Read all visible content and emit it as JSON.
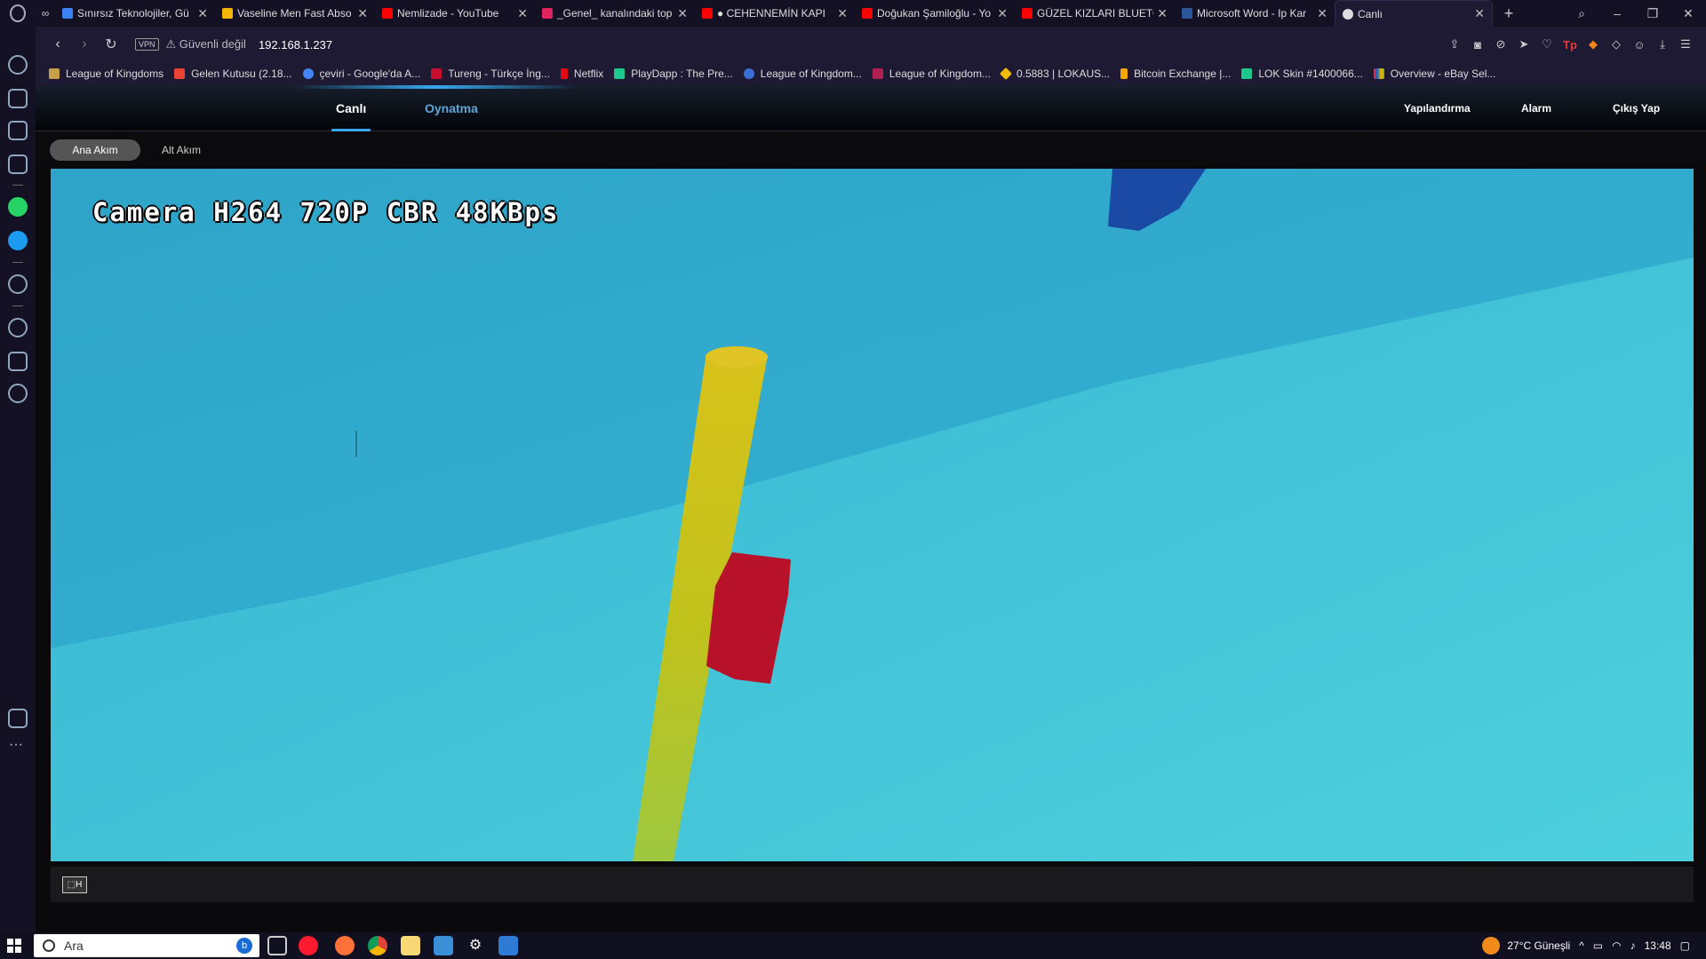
{
  "browser": {
    "tabs": [
      {
        "title": "Sınırsız Teknolojiler, Gü",
        "color": "#3b82f6"
      },
      {
        "title": "Vaseline Men Fast Abso",
        "color": "#f5b400"
      },
      {
        "title": "Nemlizade - YouTube",
        "color": "#ff0000"
      },
      {
        "title": "_Genel_ kanalındaki top",
        "color": "#e0245e"
      },
      {
        "title": "● CEHENNEMİN KAPI",
        "color": "#ff0000"
      },
      {
        "title": "Doğukan Şamiloğlu - Yo",
        "color": "#ff0000"
      },
      {
        "title": "GÜZEL KIZLARI BLUETO",
        "color": "#ff0000"
      },
      {
        "title": "Microsoft Word - Ip Kar",
        "color": "#2b579a"
      }
    ],
    "active_tab": {
      "title": "Canlı"
    },
    "new_tab": "+",
    "address": {
      "vpn": "VPN",
      "security": "⚠ Güvenli değil",
      "url": "192.168.1.237"
    },
    "bookmarks": [
      {
        "label": "League of Kingdoms",
        "color": "#c8a04a"
      },
      {
        "label": "Gelen Kutusu (2.18...",
        "color": "#ea4335"
      },
      {
        "label": "çeviri - Google'da A...",
        "color": "#4285f4"
      },
      {
        "label": "Tureng - Türkçe İng...",
        "color": "#c8102e"
      },
      {
        "label": "Netflix",
        "color": "#e50914"
      },
      {
        "label": "PlayDapp : The Pre...",
        "color": "#1ec88c"
      },
      {
        "label": "League of Kingdom...",
        "color": "#3a6fd8"
      },
      {
        "label": "League of Kingdom...",
        "color": "#b02050"
      },
      {
        "label": "0.5883 | LOKAUS...",
        "color": "#f0b90b"
      },
      {
        "label": "Bitcoin Exchange |...",
        "color": "#f7a600"
      },
      {
        "label": "LOK Skin #1400066...",
        "color": "#1ec88c"
      },
      {
        "label": "Overview - eBay Sel...",
        "color": "#e53238"
      }
    ]
  },
  "app": {
    "nav": {
      "live": "Canlı",
      "playback": "Oynatma",
      "config": "Yapılandırma",
      "alarm": "Alarm",
      "logout": "Çıkış Yap"
    },
    "streams": {
      "main": "Ana Akım",
      "sub": "Alt Akım"
    },
    "osd": "Camera H264 720P CBR 48KBps",
    "control": "⬚H"
  },
  "taskbar": {
    "search_placeholder": "Ara",
    "weather": "27°C  Güneşli",
    "time": "13:48"
  },
  "colors": {
    "accent": "#3aa8ff",
    "water": "#3ab7d0",
    "pole": "#c8b400",
    "marker": "#c0102a"
  }
}
